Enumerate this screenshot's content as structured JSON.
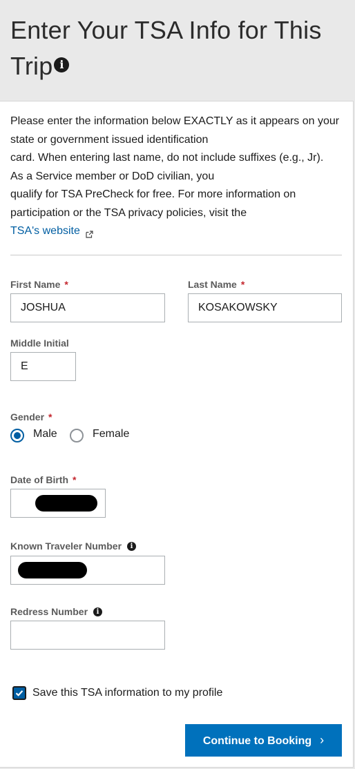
{
  "header": {
    "title": "Enter Your TSA Info for This Trip"
  },
  "intro": {
    "lines": [
      "Please enter the information below EXACTLY as it appears on your",
      "state or government issued identification",
      "card. When entering last name, do not include suffixes (e.g., Jr).",
      "As a Service member or DoD civilian, you",
      "qualify for TSA PreCheck for free. For more information on",
      "participation or the TSA privacy policies, visit the"
    ],
    "link_label": "TSA's website"
  },
  "form": {
    "first_name": {
      "label": "First Name",
      "required_mark": "*",
      "value": "JOSHUA"
    },
    "last_name": {
      "label": "Last Name",
      "required_mark": "*",
      "value": "KOSAKOWSKY"
    },
    "middle_initial": {
      "label": "Middle Initial",
      "value": "E"
    },
    "gender": {
      "label": "Gender",
      "required_mark": "*",
      "options": [
        "Male",
        "Female"
      ],
      "selected": "Male"
    },
    "date_of_birth": {
      "label": "Date of Birth",
      "required_mark": "*"
    },
    "known_traveler_number": {
      "label": "Known Traveler Number"
    },
    "redress_number": {
      "label": "Redress Number",
      "value": ""
    },
    "save_profile": {
      "label": "Save this TSA information to my profile",
      "checked": true
    },
    "submit_label": "Continue to Booking"
  },
  "colors": {
    "accent": "#005ea2",
    "button": "#0071bc",
    "required": "#c4262e",
    "header_bg": "#e9e9e9"
  },
  "icons": [
    "info-icon",
    "external-link-icon",
    "chevron-right-icon",
    "checkmark-icon"
  ]
}
